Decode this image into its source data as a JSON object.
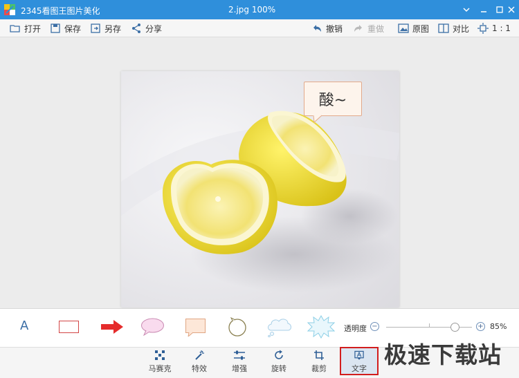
{
  "window": {
    "app_title": "2345看图王图片美化",
    "file_title": "2.jpg  100%"
  },
  "toolbar": {
    "open": "打开",
    "save": "保存",
    "save_as": "另存",
    "share": "分享",
    "undo": "撤销",
    "redo": "重做",
    "original": "原图",
    "compare": "对比",
    "ratio": "1 : 1"
  },
  "canvas": {
    "bubble_text": "酸~"
  },
  "shapes_bar": {
    "text_tool": "A",
    "opacity_label": "透明度",
    "opacity_value": "85%",
    "opacity_fraction": 0.85,
    "minus": "−",
    "plus": "+"
  },
  "bottom_tools": [
    {
      "label": "马赛克",
      "icon": "mosaic-icon"
    },
    {
      "label": "特效",
      "icon": "magic-wand-icon"
    },
    {
      "label": "增强",
      "icon": "sliders-icon"
    },
    {
      "label": "旋转",
      "icon": "rotate-icon"
    },
    {
      "label": "裁剪",
      "icon": "crop-icon"
    },
    {
      "label": "文字",
      "icon": "text-icon",
      "active": true
    }
  ],
  "watermark": "极速下载站",
  "colors": {
    "titlebar": "#2f8fdb",
    "accent_red": "#e52c2c",
    "active_border": "#d21d1d"
  }
}
